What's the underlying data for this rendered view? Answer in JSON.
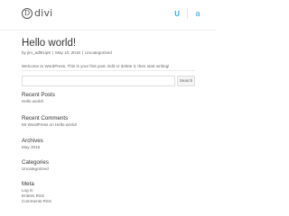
{
  "header": {
    "logo_mark": "D",
    "logo_text": "divi",
    "icons": [
      "user-icon",
      "accessibility-icon"
    ],
    "icon_user_glyph": "U",
    "icon_a_glyph": "a"
  },
  "post": {
    "title": "Hello world!",
    "meta": {
      "author": "by jim_adl91ip8",
      "date": "May 10, 2016",
      "category": "Uncategorized"
    },
    "body": "Welcome to WordPress. This is your first post. Edit or delete it, then start writing!"
  },
  "search": {
    "placeholder": "",
    "button_label": "Search"
  },
  "sidebar": {
    "recent_posts": {
      "title": "Recent Posts",
      "items": [
        "Hello world!"
      ]
    },
    "recent_comments": {
      "title": "Recent Comments",
      "items": [
        "Mr WordPress on Hello world!"
      ]
    },
    "archives": {
      "title": "Archives",
      "items": [
        "May 2016"
      ]
    },
    "categories": {
      "title": "Categories",
      "items": [
        "Uncategorized"
      ]
    },
    "meta": {
      "title": "Meta",
      "items": [
        "Log in",
        "Entries RSS",
        "Comments RSS"
      ]
    }
  },
  "colors": {
    "accent": "#2ea3f2",
    "heading": "#333333",
    "text": "#666666"
  }
}
